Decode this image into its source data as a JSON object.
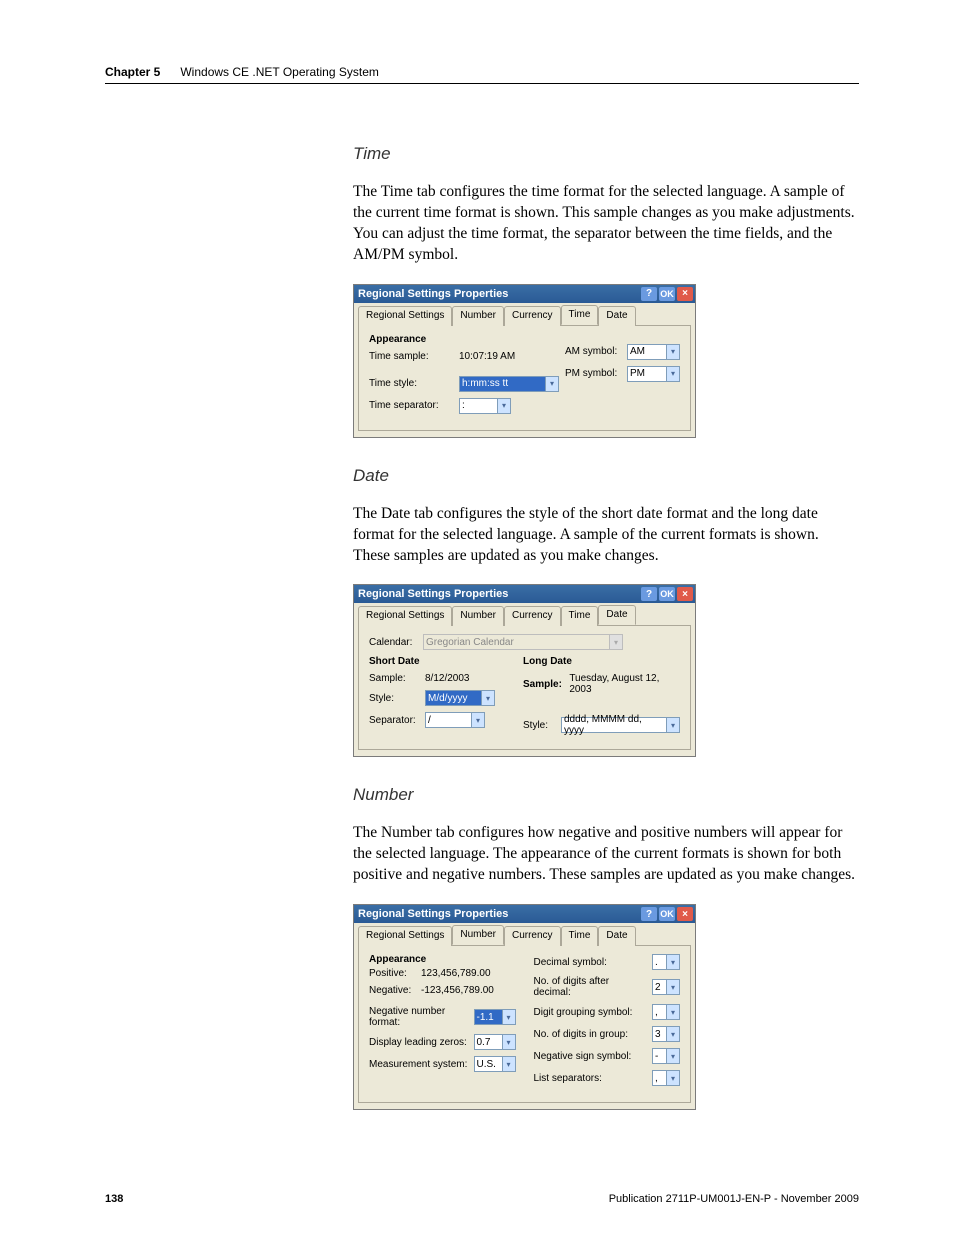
{
  "header": {
    "chapter_label": "Chapter 5",
    "chapter_title": "Windows CE .NET Operating System"
  },
  "sections": {
    "time": {
      "heading": "Time",
      "paragraph": "The Time tab configures the time format for the selected language. A sample of the current time format is shown. This sample changes as you make adjustments. You can adjust the time format, the separator between the time fields, and the AM/PM symbol."
    },
    "date": {
      "heading": "Date",
      "paragraph": "The Date tab configures the style of the short date format and the long date format for the selected language. A sample of the current formats is shown. These samples are updated as you make changes."
    },
    "number": {
      "heading": "Number",
      "paragraph": "The Number tab configures how negative and positive numbers will appear for the selected language. The appearance of the current formats is shown for both positive and negative numbers. These samples are updated as you make changes."
    }
  },
  "dialog_common": {
    "title": "Regional Settings Properties",
    "help_btn": "?",
    "ok_btn": "OK",
    "close_btn": "×",
    "tabs": {
      "regional": "Regional Settings",
      "number": "Number",
      "currency": "Currency",
      "time": "Time",
      "date": "Date"
    }
  },
  "time_dialog": {
    "appearance_label": "Appearance",
    "time_sample_label": "Time sample:",
    "time_sample_value": "10:07:19 AM",
    "time_style_label": "Time style:",
    "time_style_value": "h:mm:ss tt",
    "time_separator_label": "Time separator:",
    "time_separator_value": ":",
    "am_symbol_label": "AM symbol:",
    "am_symbol_value": "AM",
    "pm_symbol_label": "PM symbol:",
    "pm_symbol_value": "PM"
  },
  "date_dialog": {
    "calendar_label": "Calendar:",
    "calendar_value": "Gregorian Calendar",
    "short_date_heading": "Short Date",
    "long_date_heading": "Long Date",
    "sample_label": "Sample:",
    "short_sample_value": "8/12/2003",
    "long_sample_value": "Tuesday, August 12, 2003",
    "style_label": "Style:",
    "short_style_value": "M/d/yyyy",
    "long_style_value": "dddd, MMMM dd, yyyy",
    "separator_label": "Separator:",
    "separator_value": "/"
  },
  "number_dialog": {
    "appearance_label": "Appearance",
    "positive_label": "Positive:",
    "positive_value": "123,456,789.00",
    "negative_label": "Negative:",
    "negative_value": "-123,456,789.00",
    "neg_format_label": "Negative number format:",
    "neg_format_value": "-1.1",
    "leading_zeros_label": "Display leading zeros:",
    "leading_zeros_value": "0.7",
    "measurement_label": "Measurement system:",
    "measurement_value": "U.S.",
    "decimal_symbol_label": "Decimal symbol:",
    "decimal_symbol_value": ".",
    "digits_after_label": "No. of digits after decimal:",
    "digits_after_value": "2",
    "grouping_symbol_label": "Digit grouping symbol:",
    "grouping_symbol_value": ",",
    "digits_in_group_label": "No. of digits in group:",
    "digits_in_group_value": "3",
    "neg_sign_label": "Negative sign symbol:",
    "neg_sign_value": "-",
    "list_sep_label": "List separators:",
    "list_sep_value": ","
  },
  "footer": {
    "page_number": "138",
    "publication": "Publication 2711P-UM001J-EN-P - November 2009"
  }
}
